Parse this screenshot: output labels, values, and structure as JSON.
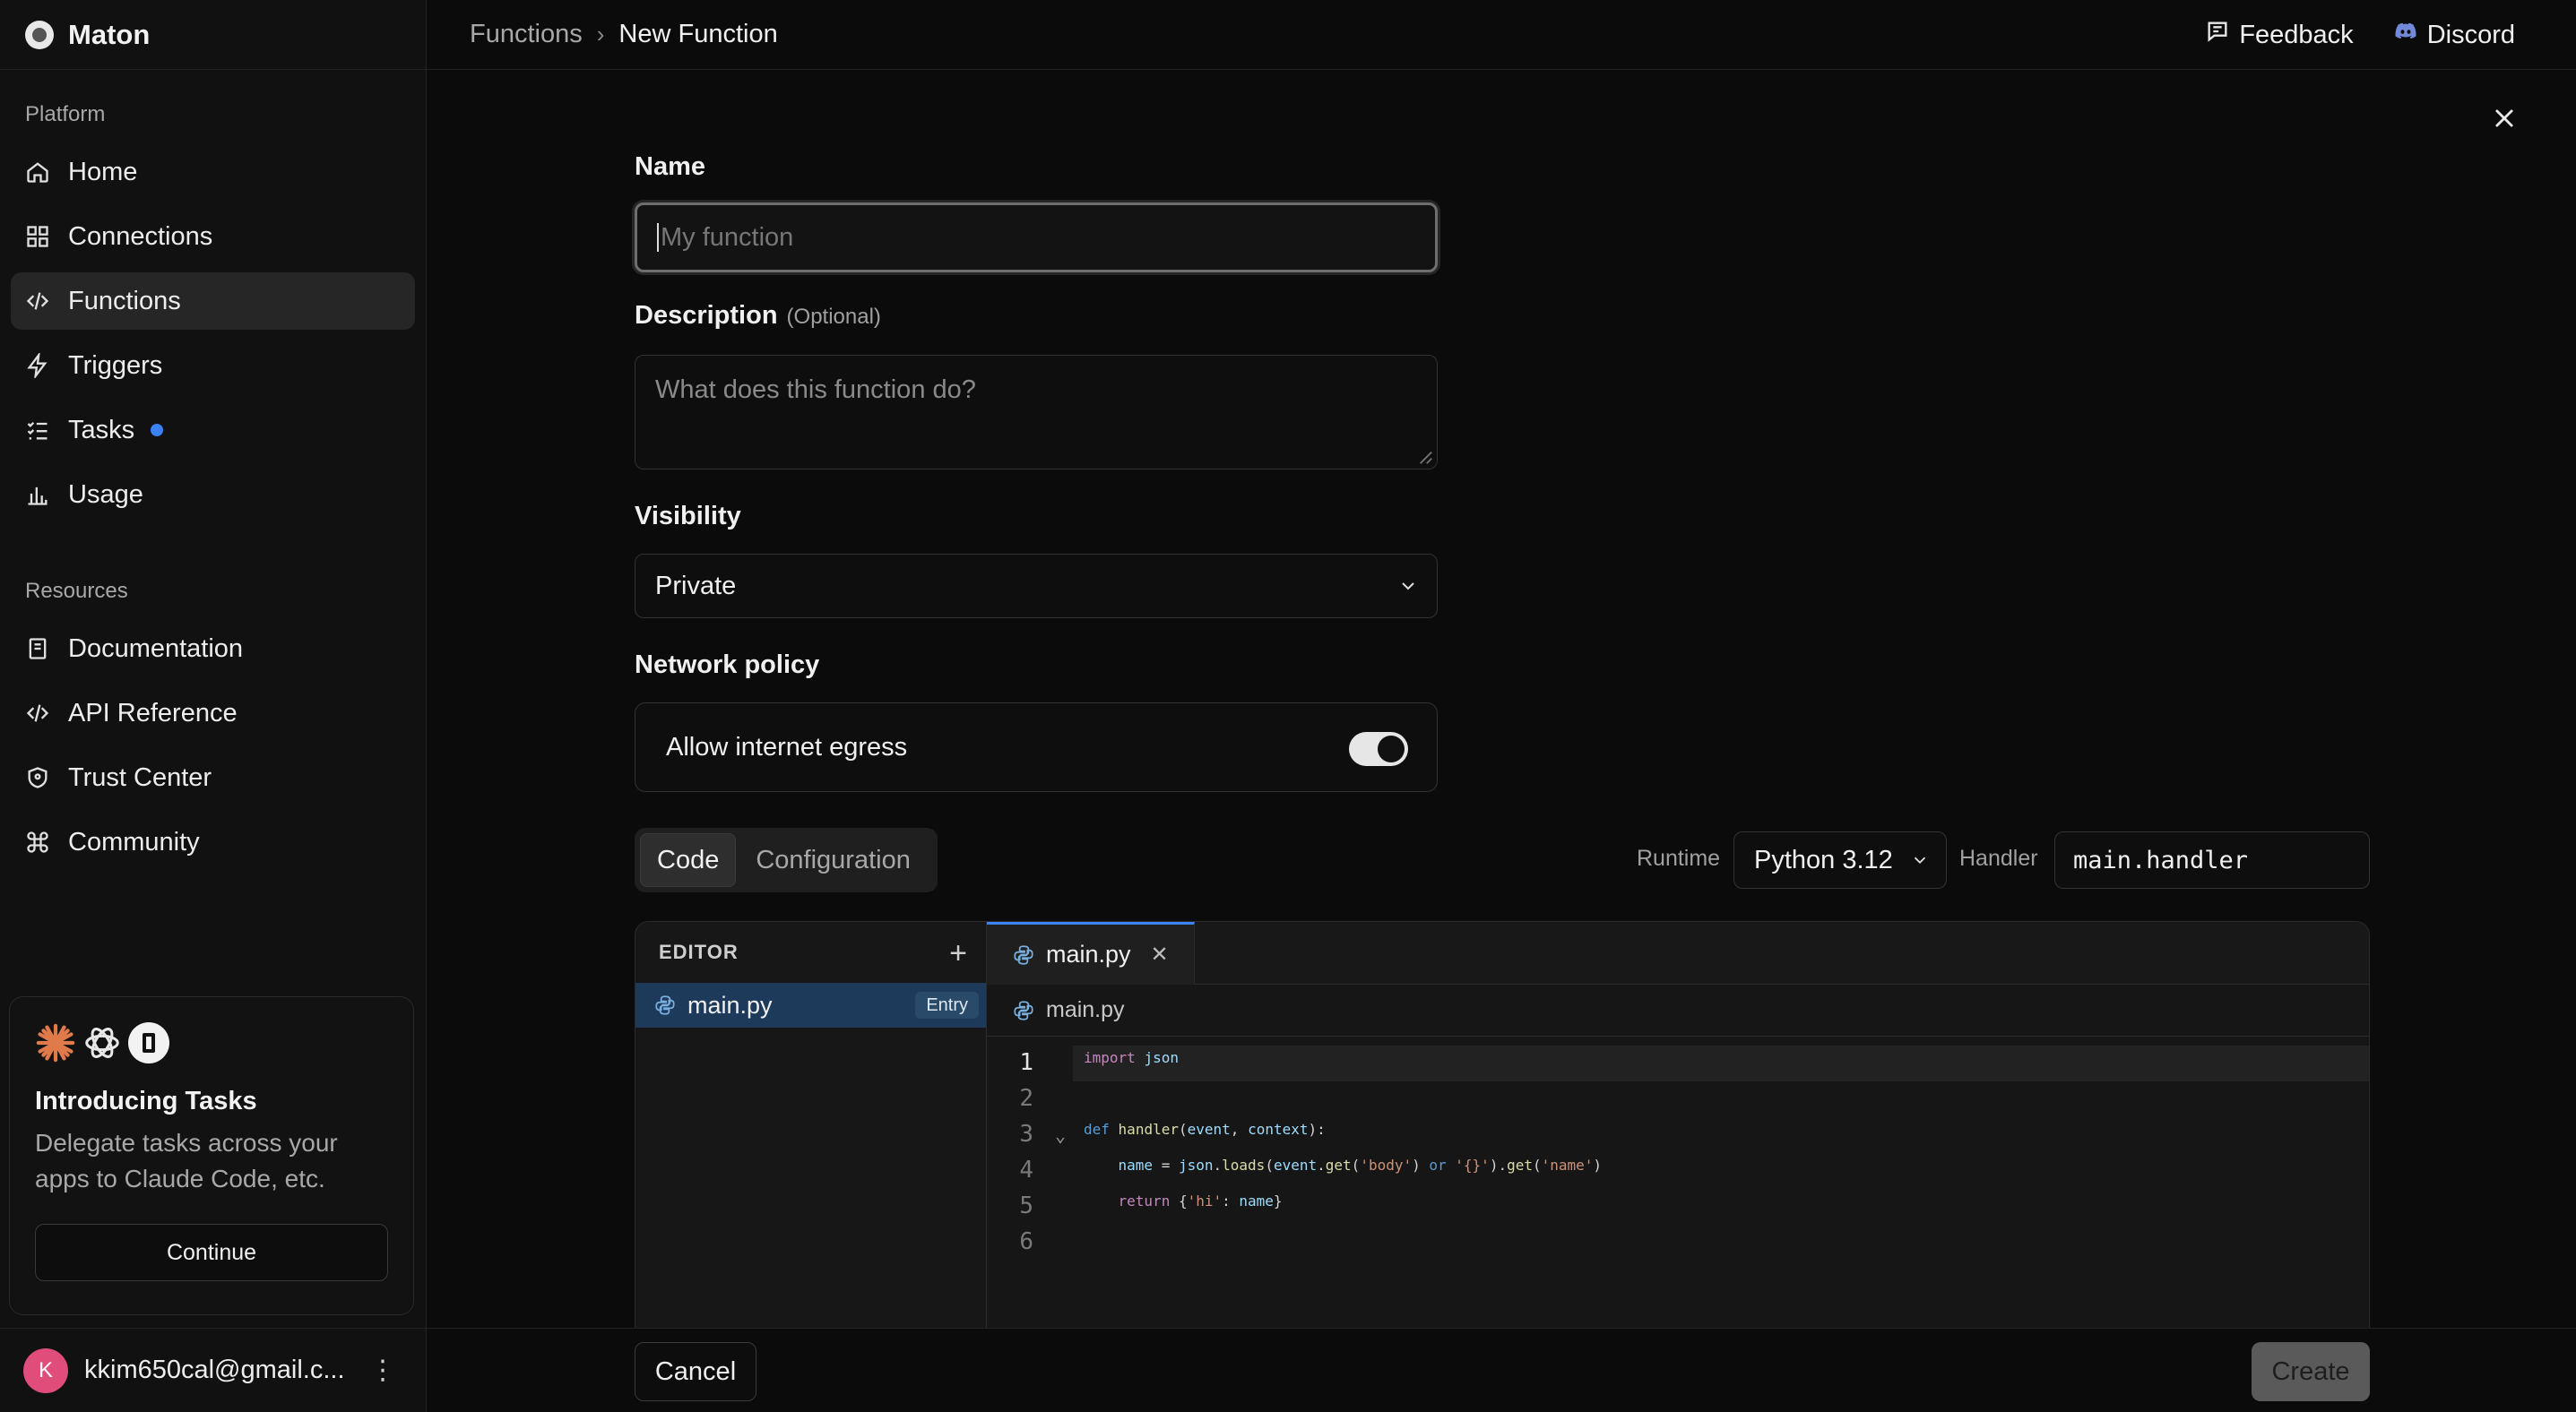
{
  "app": {
    "name": "Maton"
  },
  "sidebar": {
    "platform_label": "Platform",
    "platform_items": [
      {
        "label": "Home",
        "icon": "home-icon"
      },
      {
        "label": "Connections",
        "icon": "grid-icon"
      },
      {
        "label": "Functions",
        "icon": "code-icon",
        "active": true
      },
      {
        "label": "Triggers",
        "icon": "bolt-icon"
      },
      {
        "label": "Tasks",
        "icon": "list-check-icon",
        "badge_dot": true
      },
      {
        "label": "Usage",
        "icon": "bar-chart-icon"
      }
    ],
    "resources_label": "Resources",
    "resource_items": [
      {
        "label": "Documentation",
        "icon": "book-icon"
      },
      {
        "label": "API Reference",
        "icon": "code-icon"
      },
      {
        "label": "Trust Center",
        "icon": "shield-icon"
      },
      {
        "label": "Community",
        "icon": "command-icon"
      }
    ],
    "promo": {
      "title": "Introducing Tasks",
      "text": "Delegate tasks across your apps to Claude Code, etc.",
      "button": "Continue"
    },
    "user": {
      "initial": "K",
      "email": "kkim650cal@gmail.c..."
    }
  },
  "header": {
    "breadcrumb_parent": "Functions",
    "breadcrumb_current": "New Function",
    "feedback": "Feedback",
    "discord": "Discord"
  },
  "form": {
    "name_label": "Name",
    "name_placeholder": "My function",
    "description_label": "Description",
    "description_optional": "(Optional)",
    "description_placeholder": "What does this function do?",
    "visibility_label": "Visibility",
    "visibility_value": "Private",
    "network_label": "Network policy",
    "egress_label": "Allow internet egress",
    "egress_enabled": true
  },
  "code_section": {
    "tabs": [
      "Code",
      "Configuration"
    ],
    "active_tab": "Code",
    "runtime_label": "Runtime",
    "runtime_value": "Python 3.12",
    "handler_label": "Handler",
    "handler_value": "main.handler"
  },
  "editor": {
    "explorer_title": "EDITOR",
    "file_name": "main.py",
    "entry_badge": "Entry",
    "open_tab": "main.py",
    "path": "main.py",
    "line_numbers": [
      "1",
      "2",
      "3",
      "4",
      "5",
      "6"
    ]
  },
  "footer": {
    "cancel": "Cancel",
    "create": "Create"
  },
  "colors": {
    "accent": "#3b82f6",
    "background": "#0b0b0b",
    "sidebar": "#111111"
  }
}
